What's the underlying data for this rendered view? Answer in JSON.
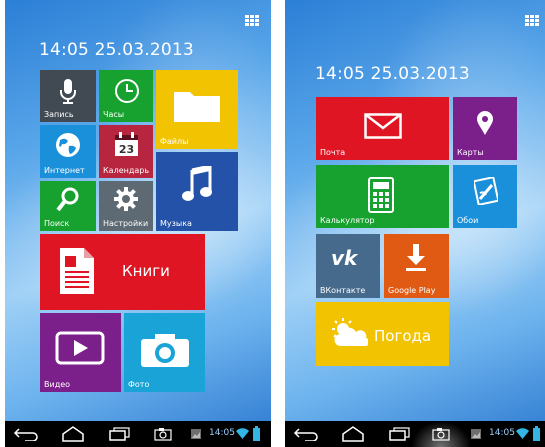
{
  "screens": [
    {
      "clock": "14:05 25.03.2013",
      "tiles": [
        {
          "label": "Запись",
          "color": "#414a53",
          "icon": "microphone-icon"
        },
        {
          "label": "Часы",
          "color": "#17a22f",
          "icon": "clock-icon"
        },
        {
          "label": "Файлы",
          "color": "#f2c300",
          "icon": "folder-icon"
        },
        {
          "label": "Интернет",
          "color": "#1a8fda",
          "icon": "globe-icon"
        },
        {
          "label": "Календарь",
          "color": "#b7253f",
          "icon": "calendar-icon",
          "badge": "23"
        },
        {
          "label": "Поиск",
          "color": "#17a22f",
          "icon": "search-icon"
        },
        {
          "label": "Настройки",
          "color": "#5e6a73",
          "icon": "gear-icon"
        },
        {
          "label": "Музыка",
          "color": "#2452a8",
          "icon": "music-note-icon"
        },
        {
          "label": "Книги",
          "color": "#e01523",
          "icon": "document-icon"
        },
        {
          "label": "Видео",
          "color": "#7b1f8a",
          "icon": "play-icon"
        },
        {
          "label": "Фото",
          "color": "#1aa3d6",
          "icon": "camera-icon"
        }
      ],
      "status_time": "14:05"
    },
    {
      "clock": "14:05 25.03.2013",
      "tiles": [
        {
          "label": "Почта",
          "color": "#e01523",
          "icon": "envelope-icon"
        },
        {
          "label": "Карты",
          "color": "#7b1f8a",
          "icon": "map-pin-icon"
        },
        {
          "label": "Калькулятор",
          "color": "#17a22f",
          "icon": "calculator-icon"
        },
        {
          "label": "Обои",
          "color": "#1a8fda",
          "icon": "wallpaper-icon"
        },
        {
          "label": "ВКонтакте",
          "color": "#466a8c",
          "icon": "vk-icon",
          "logo": "vk"
        },
        {
          "label": "Google Play",
          "color": "#e15a14",
          "icon": "download-icon"
        },
        {
          "label": "Погода",
          "color": "#f2c300",
          "icon": "weather-icon"
        }
      ],
      "status_time": "14:05"
    }
  ]
}
